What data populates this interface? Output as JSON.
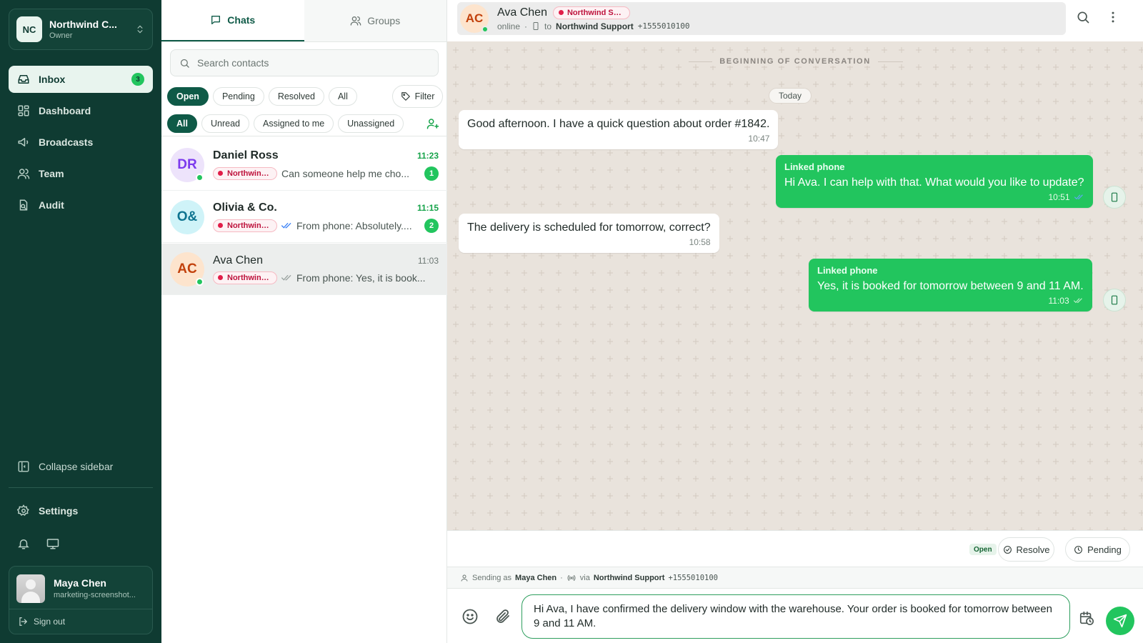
{
  "workspace": {
    "initials": "NC",
    "name": "Northwind C...",
    "role": "Owner"
  },
  "nav": {
    "items": [
      {
        "label": "Inbox",
        "icon": "inbox-icon",
        "badge": "3",
        "active": true
      },
      {
        "label": "Dashboard",
        "icon": "dashboard-icon"
      },
      {
        "label": "Broadcasts",
        "icon": "megaphone-icon"
      },
      {
        "label": "Team",
        "icon": "team-icon"
      },
      {
        "label": "Audit",
        "icon": "audit-icon"
      }
    ],
    "collapse_label": "Collapse sidebar",
    "settings_label": "Settings"
  },
  "user": {
    "name": "Maya Chen",
    "email": "marketing-screenshot...",
    "signout_label": "Sign out"
  },
  "list": {
    "tabs": [
      {
        "label": "Chats",
        "active": true
      },
      {
        "label": "Groups"
      }
    ],
    "search_placeholder": "Search contacts",
    "status_filters": [
      "Open",
      "Pending",
      "Resolved",
      "All"
    ],
    "filter_label": "Filter",
    "assign_filters": [
      "All",
      "Unread",
      "Assigned to me",
      "Unassigned"
    ],
    "conversations": [
      {
        "initials": "DR",
        "name": "Daniel Ross",
        "time": "11:23",
        "tag": "Northwind ...",
        "preview": "Can someone help me cho...",
        "unread": "1",
        "online": true,
        "avatar_bg": "#ede3fb",
        "avatar_fg": "#7c3aed"
      },
      {
        "initials": "O&",
        "name": "Olivia & Co.",
        "time": "11:15",
        "tag": "Northwind ...",
        "preview": "From phone: Absolutely....",
        "unread": "2",
        "online": false,
        "avatar_bg": "#cff3f8",
        "avatar_fg": "#0e7490"
      },
      {
        "initials": "AC",
        "name": "Ava Chen",
        "time": "11:03",
        "tag": "Northwind ...",
        "preview": "From phone: Yes, it is book...",
        "online": true,
        "avatar_bg": "#fde4cd",
        "avatar_fg": "#c2410c"
      }
    ]
  },
  "header": {
    "initials": "AC",
    "name": "Ava Chen",
    "tag": "Northwind Sup...",
    "status": "online",
    "to_label": "to",
    "channel": "Northwind Support",
    "phone": "+1555010100"
  },
  "chat": {
    "begin_label": "BEGINNING OF CONVERSATION",
    "date_label": "Today",
    "messages": [
      {
        "dir": "in",
        "text": "Good afternoon. I have a quick question about order #1842.",
        "time": "10:47"
      },
      {
        "dir": "out",
        "sender": "Linked phone",
        "text": "Hi Ava. I can help with that. What would you like to update?",
        "time": "10:51",
        "read": true
      },
      {
        "dir": "in",
        "text": "The delivery is scheduled for tomorrow, correct?",
        "time": "10:58"
      },
      {
        "dir": "out",
        "sender": "Linked phone",
        "text": "Yes, it is booked for tomorrow between 9 and 11 AM.",
        "time": "11:03",
        "read": false
      }
    ]
  },
  "status_bar": {
    "state": "Open",
    "resolve_label": "Resolve",
    "pending_label": "Pending"
  },
  "sending": {
    "prefix": "Sending as",
    "agent": "Maya Chen",
    "via": "via",
    "channel": "Northwind Support",
    "phone": "+1555010100"
  },
  "composer": {
    "value": "Hi Ava, I have confirmed the delivery window with the warehouse. Your order is booked for tomorrow between 9 and 11 AM."
  },
  "colors": {
    "sidebar": "#0f3b32",
    "accent": "#22c55e",
    "brand_dark": "#0f5a47",
    "tag": "#e11d48",
    "chat_bg": "#e9e3dc"
  }
}
